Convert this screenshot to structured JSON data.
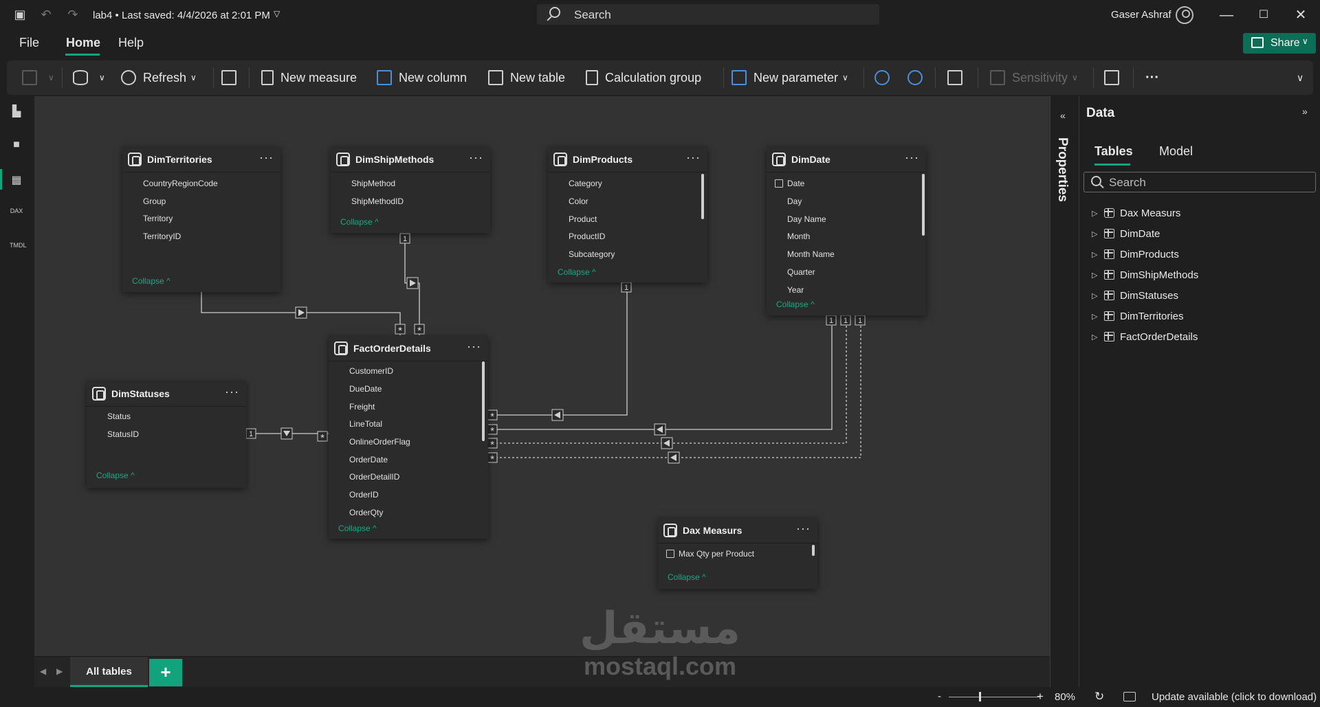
{
  "window": {
    "title": "lab4 • Last saved: 4/4/2026 at 2:01 PM",
    "search_placeholder": "Search",
    "user": "Gaser Ashraf"
  },
  "menu": {
    "file": "File",
    "home": "Home",
    "help": "Help",
    "share": "Share"
  },
  "ribbon": {
    "refresh": "Refresh",
    "new_measure": "New measure",
    "new_column": "New column",
    "new_table": "New table",
    "calculation_group": "Calculation group",
    "new_parameter": "New parameter",
    "sensitivity": "Sensitivity",
    "more": "···"
  },
  "left_rail": {
    "dax": "DAX",
    "tmdl": "TMDL"
  },
  "tables": [
    {
      "title": "DimTerritories",
      "fields": [
        "CountryRegionCode",
        "Group",
        "Territory",
        "TerritoryID"
      ],
      "collapse": "Collapse ^"
    },
    {
      "title": "DimShipMethods",
      "fields": [
        "ShipMethod",
        "ShipMethodID"
      ],
      "collapse": "Collapse ^"
    },
    {
      "title": "DimProducts",
      "fields": [
        "Category",
        "Color",
        "Product",
        "ProductID",
        "Subcategory"
      ],
      "collapse": "Collapse ^"
    },
    {
      "title": "DimDate",
      "fields": [
        "Date",
        "Day",
        "Day Name",
        "Month",
        "Month Name",
        "Quarter",
        "Year"
      ],
      "collapse": "Collapse ^"
    },
    {
      "title": "DimStatuses",
      "fields": [
        "Status",
        "StatusID"
      ],
      "collapse": "Collapse ^"
    },
    {
      "title": "FactOrderDetails",
      "fields": [
        "CustomerID",
        "DueDate",
        "Freight",
        "LineTotal",
        "OnlineOrderFlag",
        "OrderDate",
        "OrderDetailID",
        "OrderID",
        "OrderQty"
      ],
      "collapse": "Collapse ^"
    },
    {
      "title": "Dax Measurs",
      "fields": [
        "Max Qty per Product"
      ],
      "collapse": "Collapse ^"
    }
  ],
  "relationships": {
    "one": "1",
    "many": "*"
  },
  "bottom_tabs": {
    "all_tables": "All tables",
    "add": "+"
  },
  "watermark": {
    "arabic": "مستقل",
    "latin": "mostaql.com"
  },
  "statusbar": {
    "zoom_minus": "-",
    "zoom_plus": "+",
    "zoom": "80%",
    "update": "Update available (click to download)"
  },
  "properties_label": "Properties",
  "data_pane": {
    "title": "Data",
    "tabs": [
      "Tables",
      "Model"
    ],
    "search_placeholder": "Search",
    "items": [
      "Dax Measurs",
      "DimDate",
      "DimProducts",
      "DimShipMethods",
      "DimStatuses",
      "DimTerritories",
      "FactOrderDetails"
    ]
  },
  "colors": {
    "accent": "#14a57c",
    "share_bg": "#0d6e57",
    "canvas_bg": "#333333",
    "card_bg": "#2b2b2b"
  }
}
